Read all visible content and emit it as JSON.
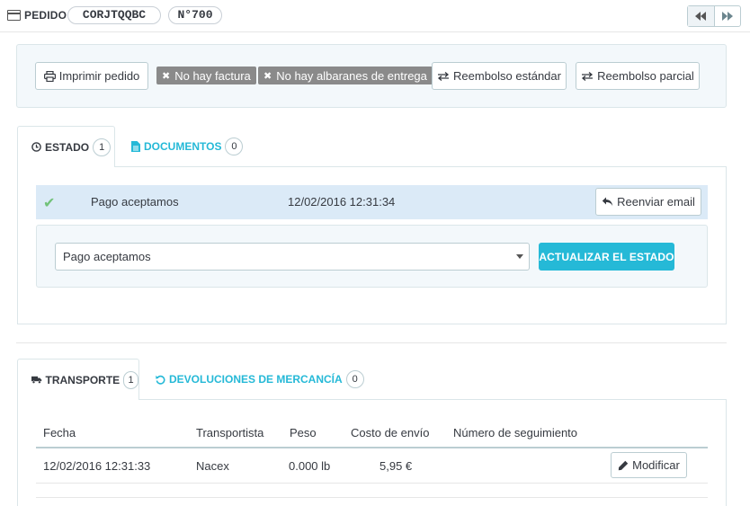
{
  "header": {
    "title": "PEDIDO",
    "reference": "CORJTQQBC",
    "order_number": "N°700"
  },
  "actions": {
    "print": "Imprimir pedido",
    "no_invoice": "No hay factura",
    "no_delivery": "No hay albaranes de entrega",
    "standard_refund": "Reembolso estándar",
    "partial_refund": "Reembolso parcial"
  },
  "status_tabs": [
    {
      "label": "ESTADO",
      "count": "1"
    },
    {
      "label": "DOCUMENTOS",
      "count": "0"
    }
  ],
  "status_history": {
    "name": "Pago aceptamos",
    "date": "12/02/2016 12:31:34",
    "resend_label": "Reenviar email"
  },
  "status_form": {
    "selected": "Pago aceptamos",
    "submit_label": "ACTUALIZAR EL ESTADO"
  },
  "shipping_tabs": [
    {
      "label": "TRANSPORTE",
      "count": "1"
    },
    {
      "label": "DEVOLUCIONES DE MERCANCÍA",
      "count": "0"
    }
  ],
  "shipping_table": {
    "columns": [
      "Fecha",
      "Transportista",
      "Peso",
      "Costo de envío",
      "Número de seguimiento"
    ],
    "rows": [
      {
        "date": "12/02/2016 12:31:33",
        "carrier": "Nacex",
        "weight": "0.000 lb",
        "cost": "5,95 €",
        "tracking": ""
      }
    ],
    "edit_label": "Modificar"
  },
  "colors": {
    "accent": "#25b9d7",
    "status_row": "#dbeaf7",
    "success": "#72c279",
    "badge_grey": "#8a8a8a"
  }
}
